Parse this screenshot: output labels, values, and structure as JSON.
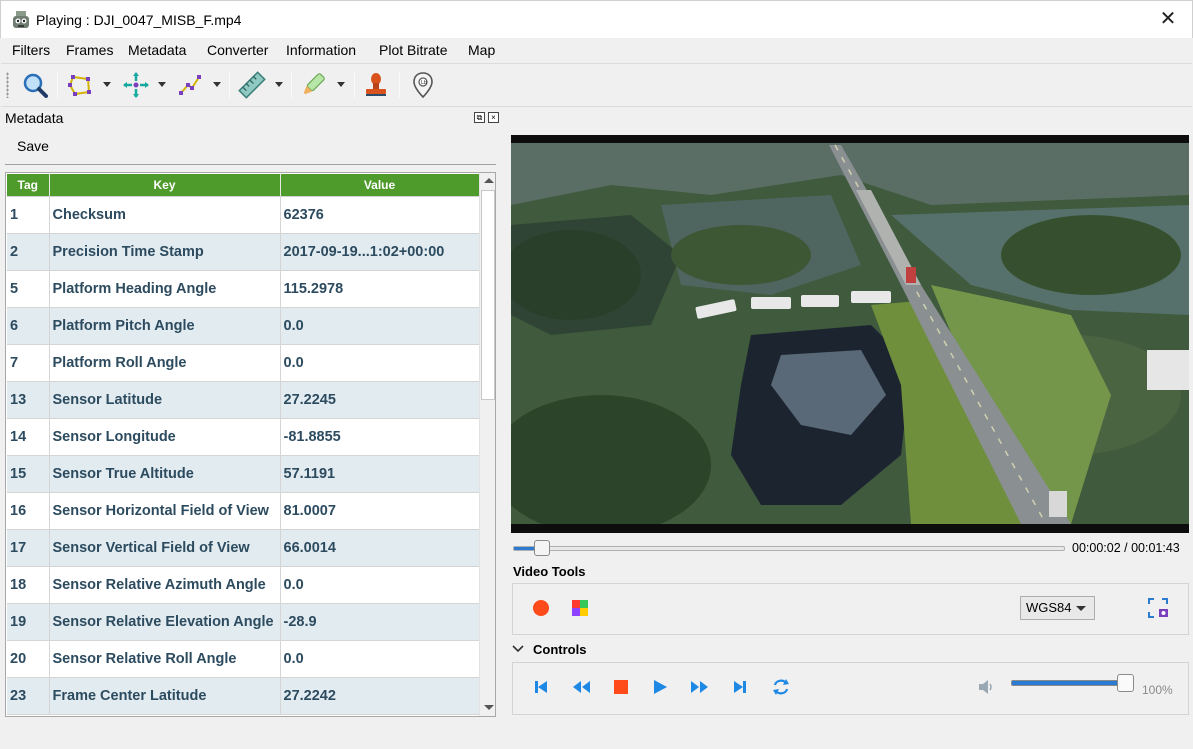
{
  "window": {
    "title": "Playing : DJI_0047_MISB_F.mp4",
    "close_glyph": "✕"
  },
  "menu": {
    "items": [
      "Filters",
      "Frames",
      "Metadata",
      "Converter",
      "Information",
      "Plot Bitrate",
      "Map"
    ]
  },
  "toolbar": {
    "icons": [
      "zoom-icon",
      "polygon-icon",
      "crosshair-icon",
      "polyline-icon",
      "ruler-icon",
      "highlighter-icon",
      "stamp-icon",
      "map-pin-icon"
    ]
  },
  "metadata_panel": {
    "title": "Metadata",
    "save_label": "Save",
    "columns": [
      "Tag",
      "Key",
      "Value"
    ],
    "rows": [
      {
        "tag": "1",
        "key": "Checksum",
        "value": "62376"
      },
      {
        "tag": "2",
        "key": "Precision Time Stamp",
        "value": "2017-09-19...1:02+00:00"
      },
      {
        "tag": "5",
        "key": "Platform Heading Angle",
        "value": "115.2978"
      },
      {
        "tag": "6",
        "key": "Platform Pitch Angle",
        "value": "0.0"
      },
      {
        "tag": "7",
        "key": "Platform Roll Angle",
        "value": "0.0"
      },
      {
        "tag": "13",
        "key": "Sensor Latitude",
        "value": "27.2245"
      },
      {
        "tag": "14",
        "key": "Sensor Longitude",
        "value": "-81.8855"
      },
      {
        "tag": "15",
        "key": "Sensor True Altitude",
        "value": "57.1191"
      },
      {
        "tag": "16",
        "key": "Sensor Horizontal Field of View",
        "value": "81.0007"
      },
      {
        "tag": "17",
        "key": "Sensor Vertical Field of View",
        "value": "66.0014"
      },
      {
        "tag": "18",
        "key": "Sensor Relative Azimuth Angle",
        "value": "0.0"
      },
      {
        "tag": "19",
        "key": "Sensor Relative Elevation Angle",
        "value": "-28.9"
      },
      {
        "tag": "20",
        "key": "Sensor Relative Roll Angle",
        "value": "0.0"
      },
      {
        "tag": "23",
        "key": "Frame Center Latitude",
        "value": "27.2242"
      }
    ]
  },
  "player": {
    "time_display": "00:00:02 / 00:01:43",
    "progress": 0.02,
    "video_tools_label": "Video Tools",
    "controls_label": "Controls",
    "crs_selected": "WGS84",
    "volume_label": "100%",
    "volume": 1.0
  },
  "colors": {
    "header_green": "#4e9a2a",
    "row_alt": "#e1ebf0",
    "accent_blue": "#2a7bd1",
    "stop_red": "#ff4500"
  }
}
